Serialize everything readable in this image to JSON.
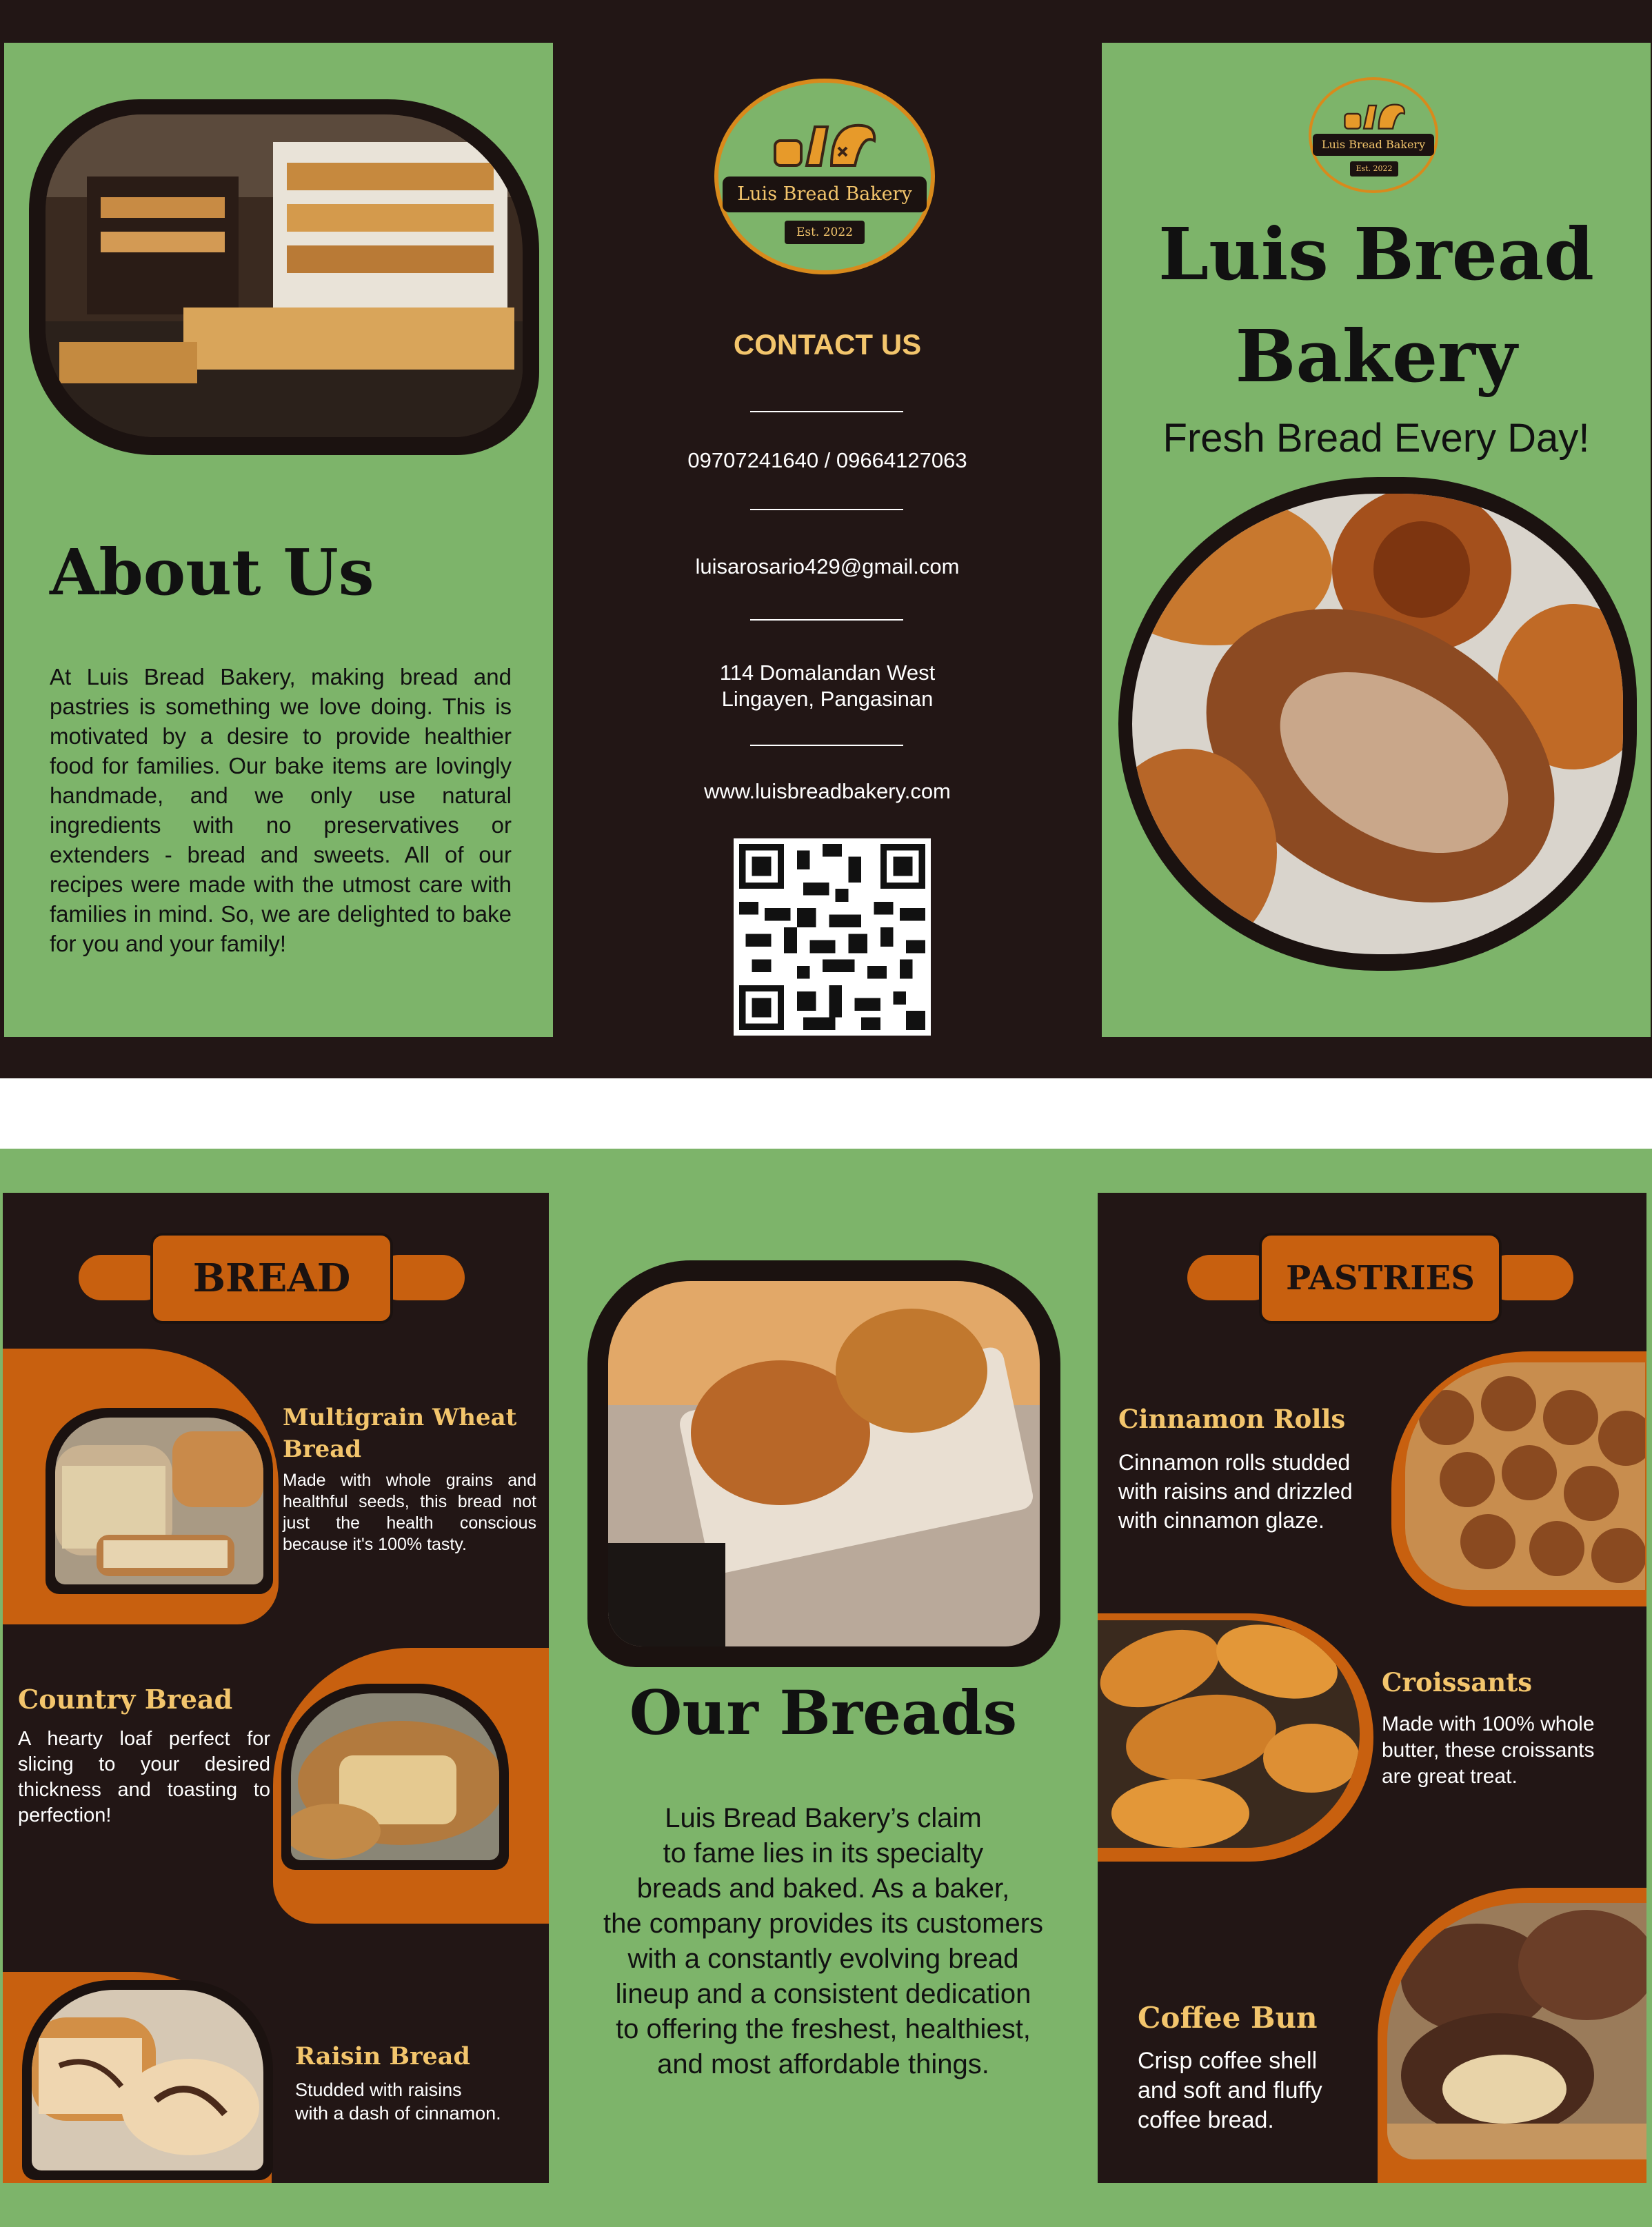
{
  "outside": {
    "about": {
      "heading": "About Us",
      "body": "At Luis Bread Bakery, making bread and pastries is something we love doing. This is motivated by a desire to provide healthier food for families. Our bake items are lovingly handmade, and we only use natural ingredients with no preservatives or extenders - bread and sweets. All of our recipes were made with the utmost care with families in mind. So, we are delighted to bake for you and your family!"
    },
    "contact": {
      "logo_name": "Luis Bread Bakery",
      "logo_est": "Est. 2022",
      "heading": "CONTACT US",
      "phone": "09707241640 / 09664127063",
      "email": "luisarosario429@gmail.com",
      "address_line1": "114 Domalandan West",
      "address_line2": "Lingayen, Pangasinan",
      "website": "www.luisbreadbakery.com"
    },
    "cover": {
      "logo_name": "Luis Bread Bakery",
      "logo_est": "Est. 2022",
      "title_line1": "Luis Bread",
      "title_line2": "Bakery",
      "tagline": "Fresh Bread Every Day!"
    }
  },
  "inside": {
    "bread": {
      "banner": "BREAD",
      "items": [
        {
          "name_line1": "Multigrain Wheat",
          "name_line2": "Bread",
          "desc": "Made with whole grains and healthful seeds, this bread not just  the health conscious because it's 100% tasty."
        },
        {
          "name": "Country Bread",
          "desc": "A hearty loaf perfect for slicing to your desired thickness and toasting to perfection!"
        },
        {
          "name": "Raisin Bread",
          "desc_line1": "Studded with raisins",
          "desc_line2": "with a dash of cinnamon."
        }
      ]
    },
    "our_breads": {
      "heading": "Our Breads",
      "body_lines": [
        "Luis Bread Bakery’s claim",
        "to fame lies in its specialty",
        "breads and baked. As a baker,",
        "the company provides its customers",
        "with a constantly evolving bread",
        "lineup and a consistent dedication",
        "to offering the freshest, healthiest,",
        "and most affordable things."
      ]
    },
    "pastries": {
      "banner": "PASTRIES",
      "items": [
        {
          "name": "Cinnamon Rolls",
          "desc_lines": [
            "Cinnamon rolls studded",
            "with raisins and drizzled",
            "with cinnamon glaze."
          ]
        },
        {
          "name": "Croissants",
          "desc_lines": [
            "Made with 100% whole",
            "butter, these croissants",
            "are great treat."
          ]
        },
        {
          "name": "Coffee Bun",
          "desc_lines": [
            "Crisp coffee shell",
            "and soft and fluffy",
            "coffee bread."
          ]
        }
      ]
    }
  },
  "colors": {
    "green": "#7db46a",
    "dark_brown": "#221615",
    "orange": "#c8600f",
    "gold": "#f3c56c"
  }
}
